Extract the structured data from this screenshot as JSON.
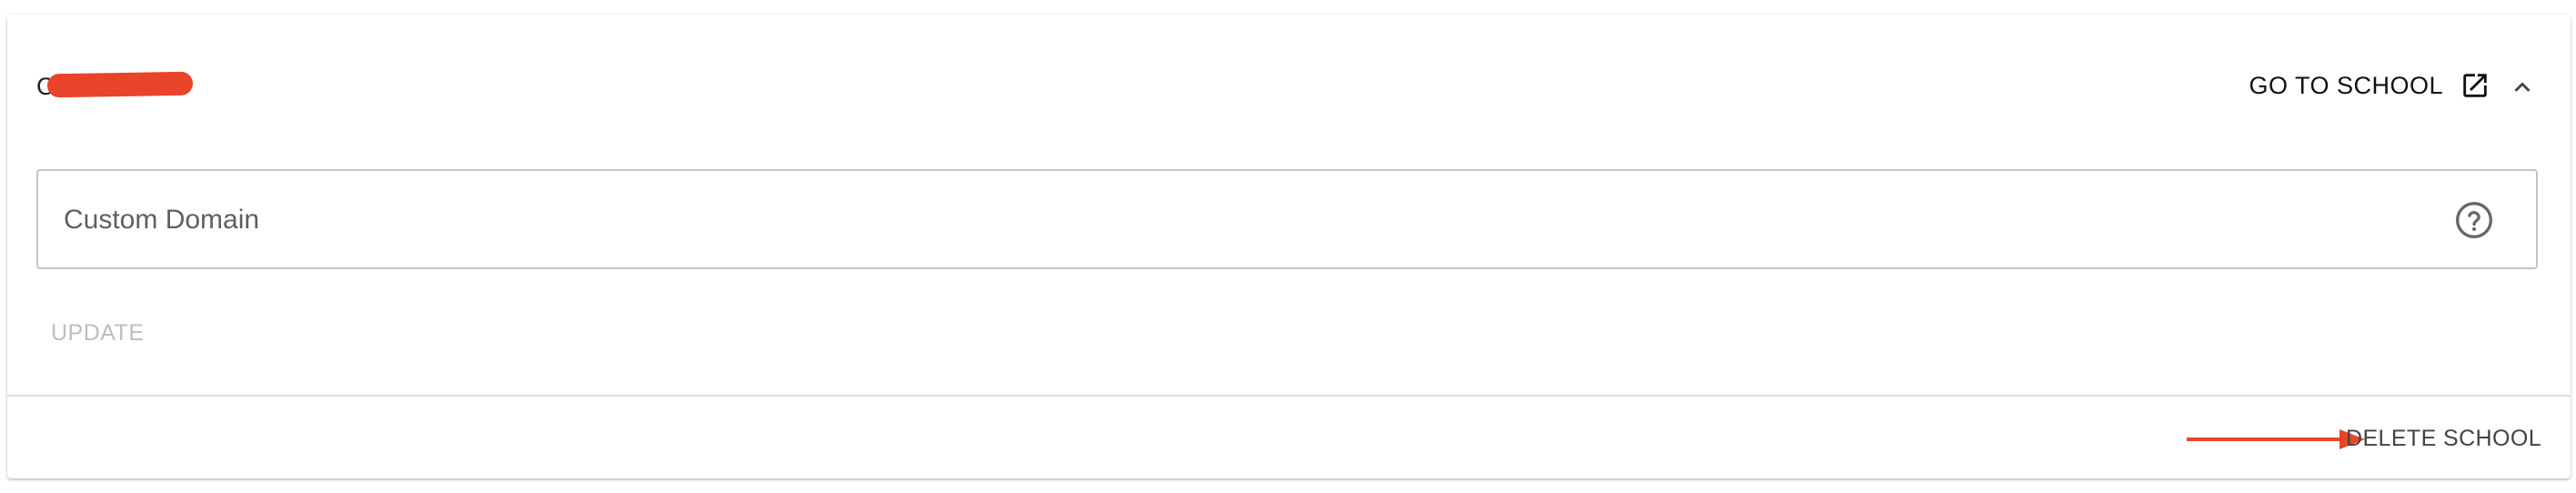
{
  "school": {
    "name": "C"
  },
  "header": {
    "go_to_school_label": "GO TO SCHOOL"
  },
  "icons": {
    "external_link": "external-link-icon",
    "collapse": "chevron-up-icon",
    "help": "help-circle-icon",
    "annotation_arrow": "arrow-right-annotation"
  },
  "custom_domain": {
    "placeholder": "Custom Domain",
    "value": ""
  },
  "actions": {
    "update_label": "UPDATE",
    "delete_label": "DELETE SCHOOL"
  },
  "colors": {
    "annotation": "#e8442a",
    "disabled_text": "#bdbdbd",
    "border": "#c4c4c4"
  }
}
